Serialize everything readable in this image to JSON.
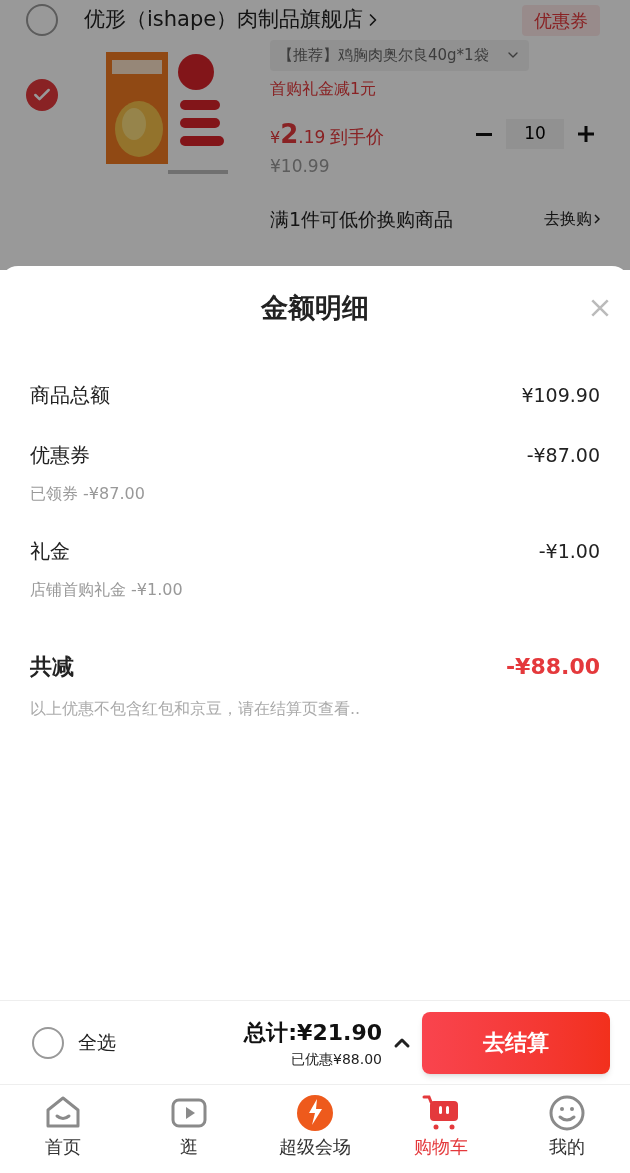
{
  "cart": {
    "shop": {
      "name": "优形（ishape）肉制品旗舰店",
      "selected": false,
      "coupon": "优惠券"
    },
    "item": {
      "selected": true,
      "spec": "【推荐】鸡胸肉奥尔良40g*1袋",
      "promo": "首购礼金减1元",
      "currency": "¥",
      "price_int": "2",
      "price_dec": ".19",
      "price_label": "到手价",
      "original_price": "¥10.99",
      "quantity": "10"
    },
    "exchange": {
      "text": "满1件可低价换购商品",
      "action": "去换购"
    }
  },
  "sheet": {
    "title": "金额明细",
    "rows": [
      {
        "label": "商品总额",
        "value": "¥109.90"
      },
      {
        "label": "优惠券",
        "value": "-¥87.00",
        "detail": "已领券 -¥87.00"
      },
      {
        "label": "礼金",
        "value": "-¥1.00",
        "detail": "店铺首购礼金 -¥1.00"
      }
    ],
    "total": {
      "label": "共减",
      "value": "-¥88.00"
    },
    "note": "以上优惠不包含红包和京豆，请在结算页查看.."
  },
  "footer": {
    "select_all": {
      "label": "全选",
      "checked": false
    },
    "total": "总计:¥21.90",
    "saved": "已优惠¥88.00",
    "checkout": "去结算"
  },
  "nav": [
    {
      "label": "首页",
      "selected": false,
      "kind": "home"
    },
    {
      "label": "逛",
      "selected": false,
      "kind": "video"
    },
    {
      "label": "超级会场",
      "selected": false,
      "kind": "promo"
    },
    {
      "label": "购物车",
      "selected": true,
      "kind": "cart"
    },
    {
      "label": "我的",
      "selected": false,
      "kind": "profile"
    }
  ]
}
